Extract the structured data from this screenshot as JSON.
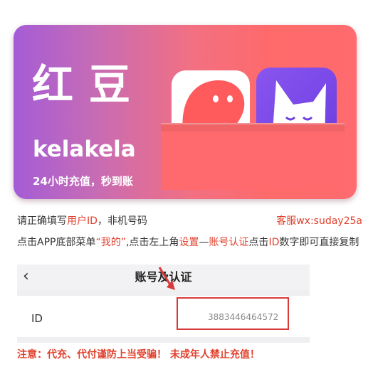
{
  "banner": {
    "title_cn": "红豆",
    "title_en": "kelakela",
    "subtitle": "24小时充值，秒到账"
  },
  "instructions": {
    "line1_prefix": "请正确填写",
    "line1_highlight": "用户ID",
    "line1_suffix": "，非机号码",
    "customer_service": "客服wx:suday25a",
    "line2_a": "点击APP底部菜单",
    "line2_b": "“我的”",
    "line2_c": ",点击左上角",
    "line2_d": "设置",
    "line2_e": "—",
    "line2_f": "账号认证",
    "line2_g": "点击",
    "line2_h": "ID",
    "line2_i": "数字即可直接复制"
  },
  "screenshot": {
    "back_glyph": "‹",
    "title": "账号及认证",
    "id_label": "ID",
    "id_value": "3883446464572"
  },
  "warning": "注意：代充、代付谨防上当受骗！ 未成年人禁止充值！",
  "colors": {
    "accent_red": "#e1402d",
    "banner_left": "#a45cd6",
    "banner_right": "#ff6b6e"
  }
}
